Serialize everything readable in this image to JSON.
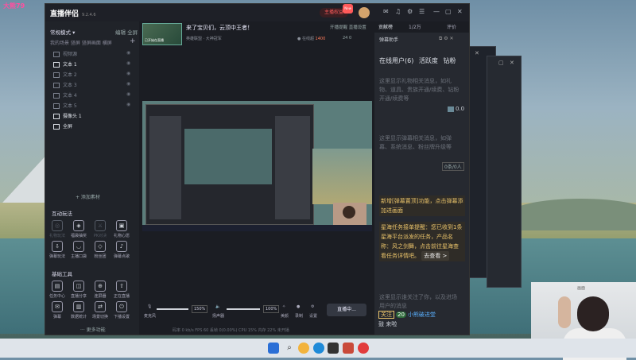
{
  "desktop": {
    "corner_label": "大熊79"
  },
  "app": {
    "logo": "直播伴侣",
    "version": "9.2.4.6",
    "host_pill": "主播权益",
    "host_pill_badge": "New",
    "right_tabs": [
      "贡献榜",
      "1/2万",
      "评价"
    ],
    "left": {
      "scene_mode": "常规模式",
      "scene_edit": "编辑",
      "scene_more": "全屏",
      "scene_tabs": "我的场景  竖屏  竖屏画面  横屏",
      "sources": [
        {
          "label": "视频源",
          "on": false
        },
        {
          "label": "文本 1",
          "on": true
        },
        {
          "label": "文本 2",
          "on": false
        },
        {
          "label": "文本 3",
          "on": false
        },
        {
          "label": "文本 4",
          "on": false
        },
        {
          "label": "文本 5",
          "on": false
        },
        {
          "label": "摄像头 1",
          "on": true
        },
        {
          "label": "全屏",
          "on": true
        }
      ],
      "add_material": "+ 添加素材",
      "interact_title": "互动玩法",
      "interact_tools": [
        "礼物玩法",
        "福袋抽奖",
        "PK对决",
        "礼物心愿",
        "弹幕玩法",
        "主播口袋",
        "粉丝团",
        "弹幕点歌"
      ],
      "basic_title": "基础工具",
      "basic_tools": [
        "任务中心",
        "直播分享",
        "连屏器",
        "正在直播",
        "弹幕",
        "数据统计",
        "场景切换",
        "下播设置"
      ],
      "more": "··· 更多功能"
    },
    "center": {
      "thumb_text": "已开始在直播",
      "room_name": "来了宝贝们，云顶中王者！",
      "room_sub": "英雄联盟  ·  大神冠军",
      "stats": "● 在线超",
      "stats_hot": "1400",
      "stats_right": "24  0",
      "toolbar_right": "开播提醒    直播设置",
      "mic_label": "麦克风",
      "mic_pct": "150%",
      "speaker_label": "扬声器",
      "speaker_pct": "100%",
      "tools": [
        "美颜",
        "录制",
        "设置"
      ],
      "live_button": "直播中...",
      "statusbar": "码率 0 kb/s    FPS 60    丢帧 0(0.00%)    CPU 15%    内存 22%    未开播"
    },
    "right": {
      "title": "弹幕助手",
      "tabs": [
        "在线用户(6)",
        "活跃度",
        "钻粉"
      ],
      "hint1": "这里显示礼物相关消息，如礼物、道具、贵族开通/续费、钻粉开通/续费等",
      "gift_count": "0.0",
      "new_badge": "0条/0人",
      "hint2": "这里显示弹幕相关消息，如弹幕、系统消息、粉丝牌升级等",
      "notice1": "新增[弹幕置顶]功能，点击弹幕添加进画面",
      "notice2": "星海任务接单提醒：您已收到1条星海平台派发的任务，产品名称：风之剑舞，点击前往星海查看任务详情吧。",
      "notice2_more": "去查看 >",
      "hint3": "这里显示谁关注了你，以及进场用户的消息",
      "follow_tag": "关注",
      "follow_level": "20",
      "follow_name": "小熊破进堂",
      "follow_tail": "鼓 来啦"
    }
  },
  "webcam": {
    "label": "画面"
  }
}
